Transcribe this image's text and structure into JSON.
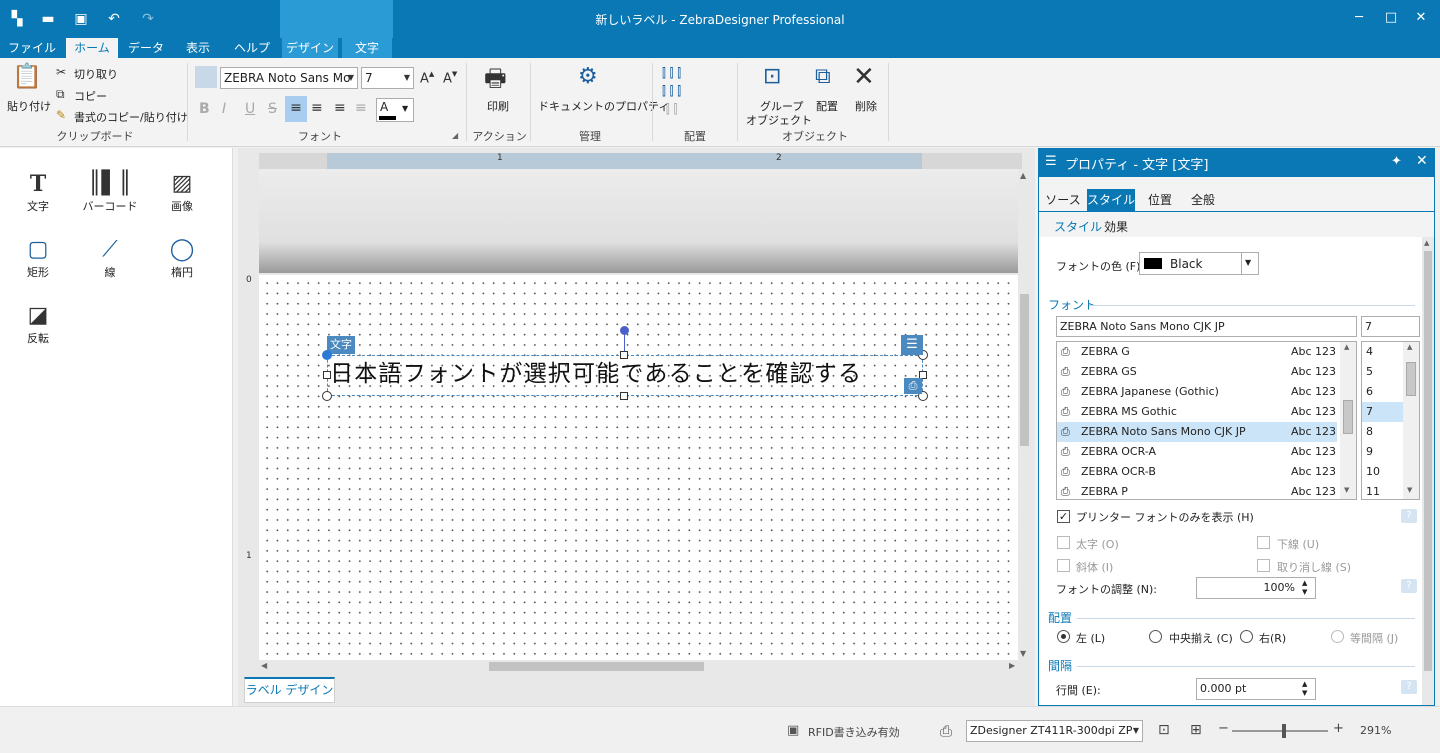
{
  "window": {
    "title": "新しいラベル - ZebraDesigner Professional"
  },
  "menu": {
    "tabs": [
      "ファイル",
      "ホーム",
      "データ",
      "表示",
      "ヘルプ",
      "デザイン",
      "文字"
    ],
    "active": "ホーム"
  },
  "ribbon": {
    "clipboard": {
      "paste": "貼り付け",
      "cut": "切り取り",
      "copy": "コピー",
      "format_copy": "書式のコピー/貼り付け",
      "group": "クリップボード"
    },
    "font": {
      "name": "ZEBRA Noto Sans Mo",
      "size": "7",
      "group": "フォント",
      "bold": "B",
      "italic": "I",
      "underline": "U",
      "strike": "S",
      "color_letter": "A"
    },
    "action": {
      "print": "印刷",
      "group": "アクション"
    },
    "manage": {
      "doc_props": "ドキュメントのプロパティ",
      "group": "管理"
    },
    "align": {
      "group": "配置"
    },
    "object": {
      "group_btn_1": "グループ",
      "group_btn_2": "オブジェクト",
      "arrange": "配置",
      "delete": "削除",
      "group": "オブジェクト"
    }
  },
  "toolbox": {
    "items": [
      "文字",
      "バーコード",
      "画像",
      "矩形",
      "線",
      "楕円",
      "反転"
    ]
  },
  "canvas": {
    "ruler": {
      "mark1": "1",
      "mark2": "2",
      "vmark0": "0",
      "vmark1": "1"
    },
    "object_tag": "文字",
    "object_text": "日本語フォントが選択可能であることを確認する",
    "design_tab": "ラベル デザイン"
  },
  "panel": {
    "title": "プロパティ - 文字 [文字]",
    "tabs": [
      "ソース",
      "スタイル",
      "位置",
      "全般"
    ],
    "active_tab": "スタイル",
    "subtabs": [
      "スタイル",
      "効果"
    ],
    "font_color_label": "フォントの色 (F):",
    "font_color_value": "Black",
    "font_section": "フォント",
    "font_name_value": "ZEBRA Noto Sans Mono CJK JP",
    "font_size_value": "7",
    "font_list": [
      {
        "name": "ZEBRA G",
        "sample": "Abc 123"
      },
      {
        "name": "ZEBRA GS",
        "sample": "Abc 123"
      },
      {
        "name": "ZEBRA Japanese (Gothic)",
        "sample": "Abc 123"
      },
      {
        "name": "ZEBRA MS Gothic",
        "sample": "Abc 123"
      },
      {
        "name": "ZEBRA Noto Sans Mono CJK JP",
        "sample": "Abc 123"
      },
      {
        "name": "ZEBRA OCR-A",
        "sample": "Abc 123"
      },
      {
        "name": "ZEBRA OCR-B",
        "sample": "Abc 123"
      },
      {
        "name": "ZEBRA P",
        "sample": "Abc 123"
      }
    ],
    "selected_font": "ZEBRA Noto Sans Mono CJK JP",
    "size_list": [
      "4",
      "5",
      "6",
      "7",
      "8",
      "9",
      "10",
      "11"
    ],
    "selected_size": "7",
    "printer_only": "プリンター フォントのみを表示 (H)",
    "bold": "太字 (O)",
    "underline": "下線 (U)",
    "italic": "斜体 (I)",
    "strike": "取り消し線 (S)",
    "font_scale_label": "フォントの調整 (N):",
    "font_scale_value": "100%",
    "align_section": "配置",
    "align_left": "左 (L)",
    "align_center": "中央揃え (C)",
    "align_right": "右(R)",
    "align_even": "等間隔 (J)",
    "spacing_section": "間隔",
    "line_spacing_label": "行間 (E):",
    "line_spacing_value": "0.000 pt",
    "help": "?"
  },
  "statusbar": {
    "rfid": "RFID書き込み有効",
    "printer": "ZDesigner ZT411R-300dpi ZP",
    "zoom": "291%"
  }
}
